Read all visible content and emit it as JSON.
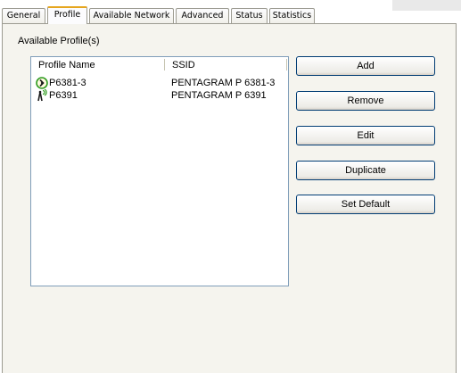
{
  "tabs": [
    {
      "label": "General"
    },
    {
      "label": "Profile"
    },
    {
      "label": "Available Network"
    },
    {
      "label": "Advanced"
    },
    {
      "label": "Status"
    },
    {
      "label": "Statistics"
    }
  ],
  "profile": {
    "group_label": "Available Profile(s)",
    "columns": {
      "name": "Profile Name",
      "ssid": "SSID"
    },
    "rows": [
      {
        "name": "P6381-3",
        "ssid": "PENTAGRAM P 6381-3",
        "icon": "active-signal-icon"
      },
      {
        "name": "P6391",
        "ssid": "PENTAGRAM P 6391",
        "icon": "antenna-signal-icon"
      }
    ]
  },
  "buttons": {
    "add": "Add",
    "remove": "Remove",
    "edit": "Edit",
    "duplicate": "Duplicate",
    "set_default": "Set Default"
  }
}
